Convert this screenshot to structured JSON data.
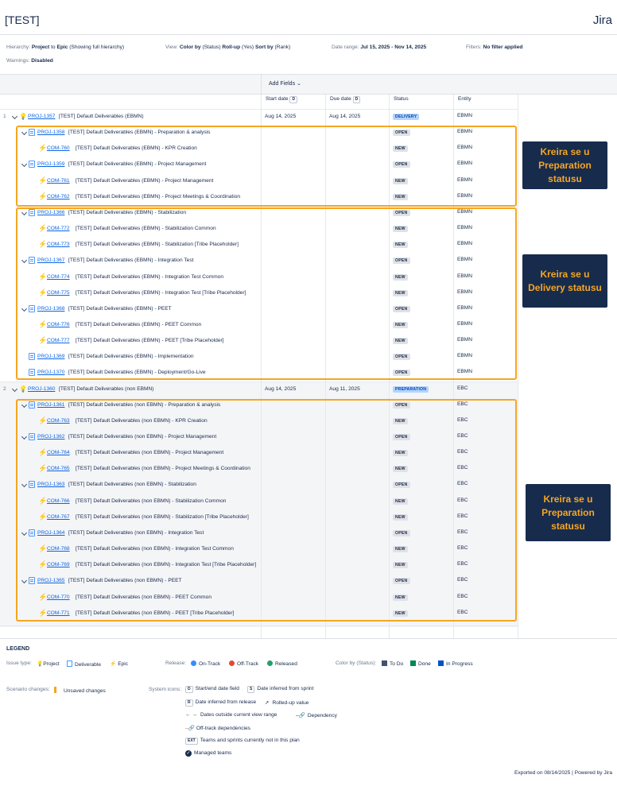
{
  "app": {
    "title": "[TEST]",
    "brand": "Jira"
  },
  "meta": {
    "hierarchy_label": "Hierarchy:",
    "hierarchy_value": "Project",
    "hierarchy_to": "to",
    "hierarchy_value2": "Epic",
    "hierarchy_note": "(Showing full hierarchy)",
    "view_label": "View:",
    "color_by": "Color by",
    "color_by_val": "(Status)",
    "rollup": "Roll-up",
    "rollup_val": "(Yes)",
    "sort_by": "Sort by",
    "sort_by_val": "(Rank)",
    "date_range_label": "Date range:",
    "date_range_value": "Jul 15, 2025 - Nov 14, 2025",
    "filters_label": "Filters:",
    "filters_value": "No filter applied",
    "warnings_label": "Warnings:",
    "warnings_value": "Disabled"
  },
  "grid": {
    "add_fields": "Add Fields",
    "columns": {
      "start": "Start date",
      "due": "Due date",
      "status": "Status",
      "entity": "Entity",
      "date_badge": "D"
    }
  },
  "rows": [
    {
      "num": "1",
      "type": "project",
      "key": "PROJ-1357",
      "summary": "[TEST] Default Deliverables (EBMN)",
      "start": "Aug 14, 2025",
      "due": "Aug 14, 2025",
      "status": "DELIVERY",
      "status_kind": "prog",
      "entity": "EBMN",
      "chev": true
    },
    {
      "type": "deliverable",
      "key": "PROJ-1358",
      "summary": "[TEST] Default Deliverables (EBMN) - Preparation & analysis",
      "status": "OPEN",
      "status_kind": "todo",
      "entity": "EBMN",
      "chev": true
    },
    {
      "type": "epic",
      "key": "COM-760",
      "summary": "[TEST] Default Deliverables (EBMN) - KPR Creation",
      "status": "NEW",
      "status_kind": "todo",
      "entity": "EBMN"
    },
    {
      "type": "deliverable",
      "key": "PROJ-1359",
      "summary": "[TEST] Default Deliverables (EBMN) - Project Management",
      "status": "OPEN",
      "status_kind": "todo",
      "entity": "EBMN",
      "chev": true
    },
    {
      "type": "epic",
      "key": "COM-761",
      "summary": "[TEST] Default Deliverables (EBMN) - Project Management",
      "status": "NEW",
      "status_kind": "todo",
      "entity": "EBMN"
    },
    {
      "type": "epic",
      "key": "COM-762",
      "summary": "[TEST] Default Deliverables (EBMN) - Project Meetings & Coordination",
      "status": "NEW",
      "status_kind": "todo",
      "entity": "EBMN"
    },
    {
      "type": "deliverable",
      "key": "PROJ-1366",
      "summary": "[TEST] Default Deliverables (EBMN) - Stabilization",
      "status": "OPEN",
      "status_kind": "todo",
      "entity": "EBMN",
      "chev": true
    },
    {
      "type": "epic",
      "key": "COM-772",
      "summary": "[TEST] Default Deliverables (EBMN) - Stabilization Common",
      "status": "NEW",
      "status_kind": "todo",
      "entity": "EBMN"
    },
    {
      "type": "epic",
      "key": "COM-773",
      "summary": "[TEST] Default Deliverables (EBMN) - Stabilization [Tribe Placeholder]",
      "status": "NEW",
      "status_kind": "todo",
      "entity": "EBMN"
    },
    {
      "type": "deliverable",
      "key": "PROJ-1367",
      "summary": "[TEST] Default Deliverables (EBMN) - Integration Test",
      "status": "OPEN",
      "status_kind": "todo",
      "entity": "EBMN",
      "chev": true
    },
    {
      "type": "epic",
      "key": "COM-774",
      "summary": "[TEST] Default Deliverables (EBMN) - Integration Test Common",
      "status": "NEW",
      "status_kind": "todo",
      "entity": "EBMN"
    },
    {
      "type": "epic",
      "key": "COM-775",
      "summary": "[TEST] Default Deliverables (EBMN) - Integration Test [Tribe Placeholder]",
      "status": "NEW",
      "status_kind": "todo",
      "entity": "EBMN"
    },
    {
      "type": "deliverable",
      "key": "PROJ-1368",
      "summary": "[TEST] Default Deliverables (EBMN) - PEET",
      "status": "OPEN",
      "status_kind": "todo",
      "entity": "EBMN",
      "chev": true
    },
    {
      "type": "epic",
      "key": "COM-776",
      "summary": "[TEST] Default Deliverables (EBMN) - PEET Common",
      "status": "NEW",
      "status_kind": "todo",
      "entity": "EBMN"
    },
    {
      "type": "epic",
      "key": "COM-777",
      "summary": "[TEST] Default Deliverables (EBMN) - PEET [Tribe Placeholder]",
      "status": "NEW",
      "status_kind": "todo",
      "entity": "EBMN"
    },
    {
      "type": "deliverable",
      "key": "PROJ-1369",
      "summary": "[TEST] Default Deliverables (EBMN) - Implementation",
      "status": "OPEN",
      "status_kind": "todo",
      "entity": "EBMN"
    },
    {
      "type": "deliverable",
      "key": "PROJ-1370",
      "summary": "[TEST] Default Deliverables (EBMN) - Deployment/Go-Live",
      "status": "OPEN",
      "status_kind": "todo",
      "entity": "EBMN"
    },
    {
      "num": "2",
      "type": "project",
      "key": "PROJ-1360",
      "summary": "[TEST] Default Deliverables (non EBMN)",
      "start": "Aug 14, 2025",
      "due": "Aug 11, 2025",
      "status": "PREPARATION",
      "status_kind": "prog",
      "entity": "EBC",
      "chev": true
    },
    {
      "type": "deliverable",
      "key": "PROJ-1361",
      "summary": "[TEST] Default Deliverables (non EBMN) - Preparation & analysis",
      "status": "OPEN",
      "status_kind": "todo",
      "entity": "EBC",
      "chev": true
    },
    {
      "type": "epic",
      "key": "COM-763",
      "summary": "[TEST] Default Deliverables (non EBMN) - KPR Creation",
      "status": "NEW",
      "status_kind": "todo",
      "entity": "EBC"
    },
    {
      "type": "deliverable",
      "key": "PROJ-1362",
      "summary": "[TEST] Default Deliverables (non EBMN) - Project Management",
      "status": "OPEN",
      "status_kind": "todo",
      "entity": "EBC",
      "chev": true
    },
    {
      "type": "epic",
      "key": "COM-764",
      "summary": "[TEST] Default Deliverables (non EBMN) - Project Management",
      "status": "NEW",
      "status_kind": "todo",
      "entity": "EBC"
    },
    {
      "type": "epic",
      "key": "COM-765",
      "summary": "[TEST] Default Deliverables (non EBMN) - Project Meetings & Coordination",
      "status": "NEW",
      "status_kind": "todo",
      "entity": "EBC"
    },
    {
      "type": "deliverable",
      "key": "PROJ-1363",
      "summary": "[TEST] Default Deliverables (non EBMN) - Stabilization",
      "status": "OPEN",
      "status_kind": "todo",
      "entity": "EBC",
      "chev": true
    },
    {
      "type": "epic",
      "key": "COM-766",
      "summary": "[TEST] Default Deliverables (non EBMN) - Stabilization Common",
      "status": "NEW",
      "status_kind": "todo",
      "entity": "EBC"
    },
    {
      "type": "epic",
      "key": "COM-767",
      "summary": "[TEST] Default Deliverables (non EBMN) - Stabilization [Tribe Placeholder]",
      "status": "NEW",
      "status_kind": "todo",
      "entity": "EBC"
    },
    {
      "type": "deliverable",
      "key": "PROJ-1364",
      "summary": "[TEST] Default Deliverables (non EBMN) - Integration Test",
      "status": "OPEN",
      "status_kind": "todo",
      "entity": "EBC",
      "chev": true
    },
    {
      "type": "epic",
      "key": "COM-768",
      "summary": "[TEST] Default Deliverables (non EBMN) - Integration Test Common",
      "status": "NEW",
      "status_kind": "todo",
      "entity": "EBC"
    },
    {
      "type": "epic",
      "key": "COM-769",
      "summary": "[TEST] Default Deliverables (non EBMN) - Integration Test [Tribe Placeholder]",
      "status": "NEW",
      "status_kind": "todo",
      "entity": "EBC"
    },
    {
      "type": "deliverable",
      "key": "PROJ-1365",
      "summary": "[TEST] Default Deliverables (non EBMN) - PEET",
      "status": "OPEN",
      "status_kind": "todo",
      "entity": "EBC",
      "chev": true
    },
    {
      "type": "epic",
      "key": "COM-770",
      "summary": "[TEST] Default Deliverables (non EBMN) - PEET Common",
      "status": "NEW",
      "status_kind": "todo",
      "entity": "EBC"
    },
    {
      "type": "epic",
      "key": "COM-771",
      "summary": "[TEST] Default Deliverables (non EBMN) - PEET [Tribe Placeholder]",
      "status": "NEW",
      "status_kind": "todo",
      "entity": "EBC"
    }
  ],
  "annotations": [
    {
      "text": "Kreira se u Preparation statusu"
    },
    {
      "text": "Kreira se u Delivery statusu"
    },
    {
      "text": "Kreira se u Preparation statusu"
    }
  ],
  "colors": {
    "accent_orange": "#f5a623",
    "note_bg": "#172b4d",
    "link": "#0c66e4",
    "todo": "#42526e",
    "done": "#00875a",
    "in_progress": "#0052cc"
  },
  "legend": {
    "title": "LEGEND",
    "issue_type_label": "Issue type:",
    "issue_types": [
      "Project",
      "Deliverable",
      "Epic"
    ],
    "release_label": "Release:",
    "releases": [
      "On-Track",
      "Off-Track",
      "Released"
    ],
    "color_by_label": "Color by (Status):",
    "statuses": [
      "To Do",
      "Done",
      "In Progress"
    ],
    "scenario_label": "Scenario changes:",
    "unsaved": "Unsaved changes",
    "system_icons_label": "System icons:",
    "sys": {
      "startend": "Start/end date field",
      "sprint": "Date inferred from sprint",
      "release": "Date inferred from release",
      "rolled": "Rolled-up value",
      "outside": "Dates outside current view range",
      "dependency": "Dependency",
      "offtrack": "Off-track dependencies",
      "ext": "Teams and sprints currently not in this plan",
      "managed": "Managed teams",
      "badge_d": "D",
      "badge_s": "S",
      "badge_r": "R",
      "badge_ext": "EXT"
    }
  },
  "footer": "Exported on 08/14/2025 | Powered by Jira"
}
